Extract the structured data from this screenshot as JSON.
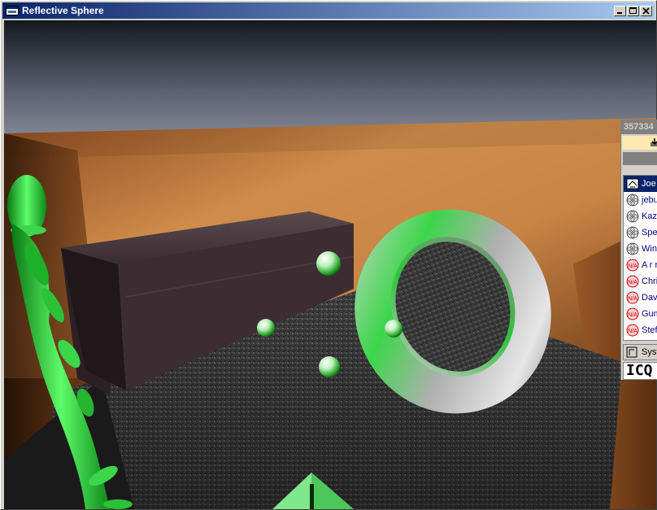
{
  "window": {
    "title": "Reflective Sphere",
    "icon": "app-window-icon",
    "controls": [
      "minimize-icon",
      "maximize-icon",
      "close-icon"
    ]
  },
  "scene": {
    "description_icons": [
      "figure-icon",
      "torus-icon",
      "sphere-icon"
    ],
    "colors": {
      "sky": "#5f6570",
      "wall": "#c0803a",
      "floor": "#3a3a3a",
      "accent_green": "#3cd64a",
      "torus_grey": "#b8b8b8"
    }
  },
  "chat_panel": {
    "title": "357334",
    "contacts": [
      {
        "name": "Joe",
        "icon": "network-user-icon",
        "selected": true
      },
      {
        "name": "jebu",
        "icon": "flower-icon",
        "selected": false
      },
      {
        "name": "Kaza",
        "icon": "flower-icon",
        "selected": false
      },
      {
        "name": "Sper",
        "icon": "flower-icon",
        "selected": false
      },
      {
        "name": "Wins",
        "icon": "flower-icon",
        "selected": false
      },
      {
        "name": "A r r",
        "icon": "na-badge-icon",
        "selected": false
      },
      {
        "name": "Chris",
        "icon": "na-badge-icon",
        "selected": false
      },
      {
        "name": "Dav",
        "icon": "na-badge-icon",
        "selected": false
      },
      {
        "name": "Gum",
        "icon": "na-badge-icon",
        "selected": false
      },
      {
        "name": "Steff",
        "icon": "na-badge-icon",
        "selected": false
      }
    ],
    "system_label": "Syst",
    "logo_text": "ICQ"
  }
}
